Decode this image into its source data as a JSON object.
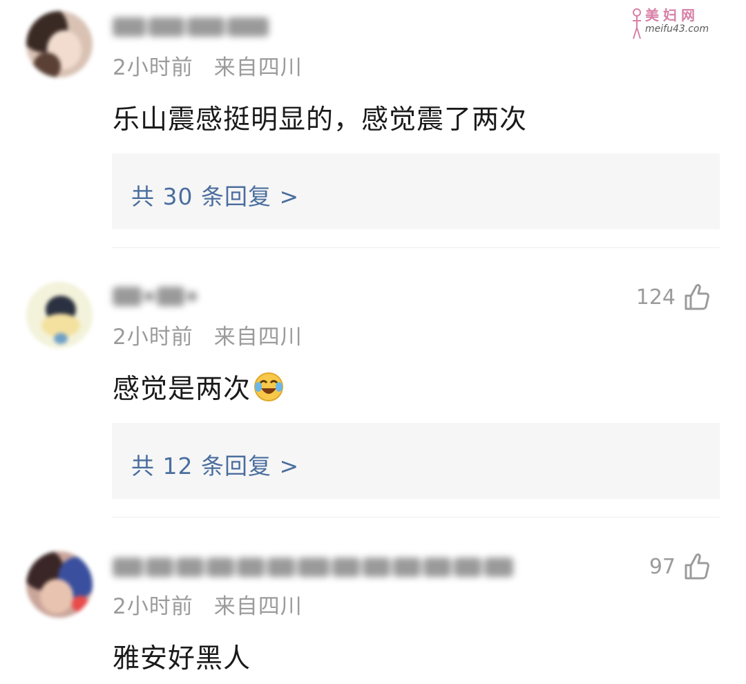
{
  "watermark": {
    "text": "美妇网",
    "url": "meifu43.com"
  },
  "comments": [
    {
      "time": "2小时前",
      "location": "来自四川",
      "text": "乐山震感挺明显的，感觉震了两次",
      "likes": null,
      "replies_label": "共 30 条回复 >"
    },
    {
      "time": "2小时前",
      "location": "来自四川",
      "text": "感觉是两次",
      "emoji": "laughing-crying-emoji",
      "likes": "124",
      "replies_label": "共 12 条回复 >"
    },
    {
      "time": "2小时前",
      "location": "来自四川",
      "text": "雅安好黑人",
      "likes": "97"
    }
  ],
  "icons": {
    "like": "thumbs-up-icon"
  },
  "colors": {
    "meta": "#9b9b9b",
    "reply_link": "#4a6e9e",
    "reply_bg": "#f6f6f6",
    "text": "#1a1a1a"
  }
}
